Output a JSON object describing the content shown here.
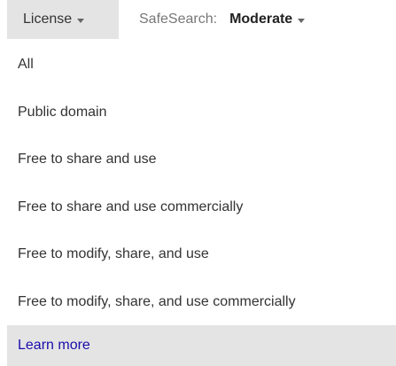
{
  "toolbar": {
    "license_label": "License",
    "safesearch_label": "SafeSearch:",
    "safesearch_value": "Moderate"
  },
  "license_menu": {
    "items": [
      {
        "label": "All"
      },
      {
        "label": "Public domain"
      },
      {
        "label": "Free to share and use"
      },
      {
        "label": "Free to share and use commercially"
      },
      {
        "label": "Free to modify, share, and use"
      },
      {
        "label": "Free to modify, share, and use commercially"
      }
    ],
    "learn_more_label": "Learn more"
  },
  "colors": {
    "highlight_bg": "#e4e4e4",
    "link": "#1a0dab",
    "text": "#333333"
  }
}
